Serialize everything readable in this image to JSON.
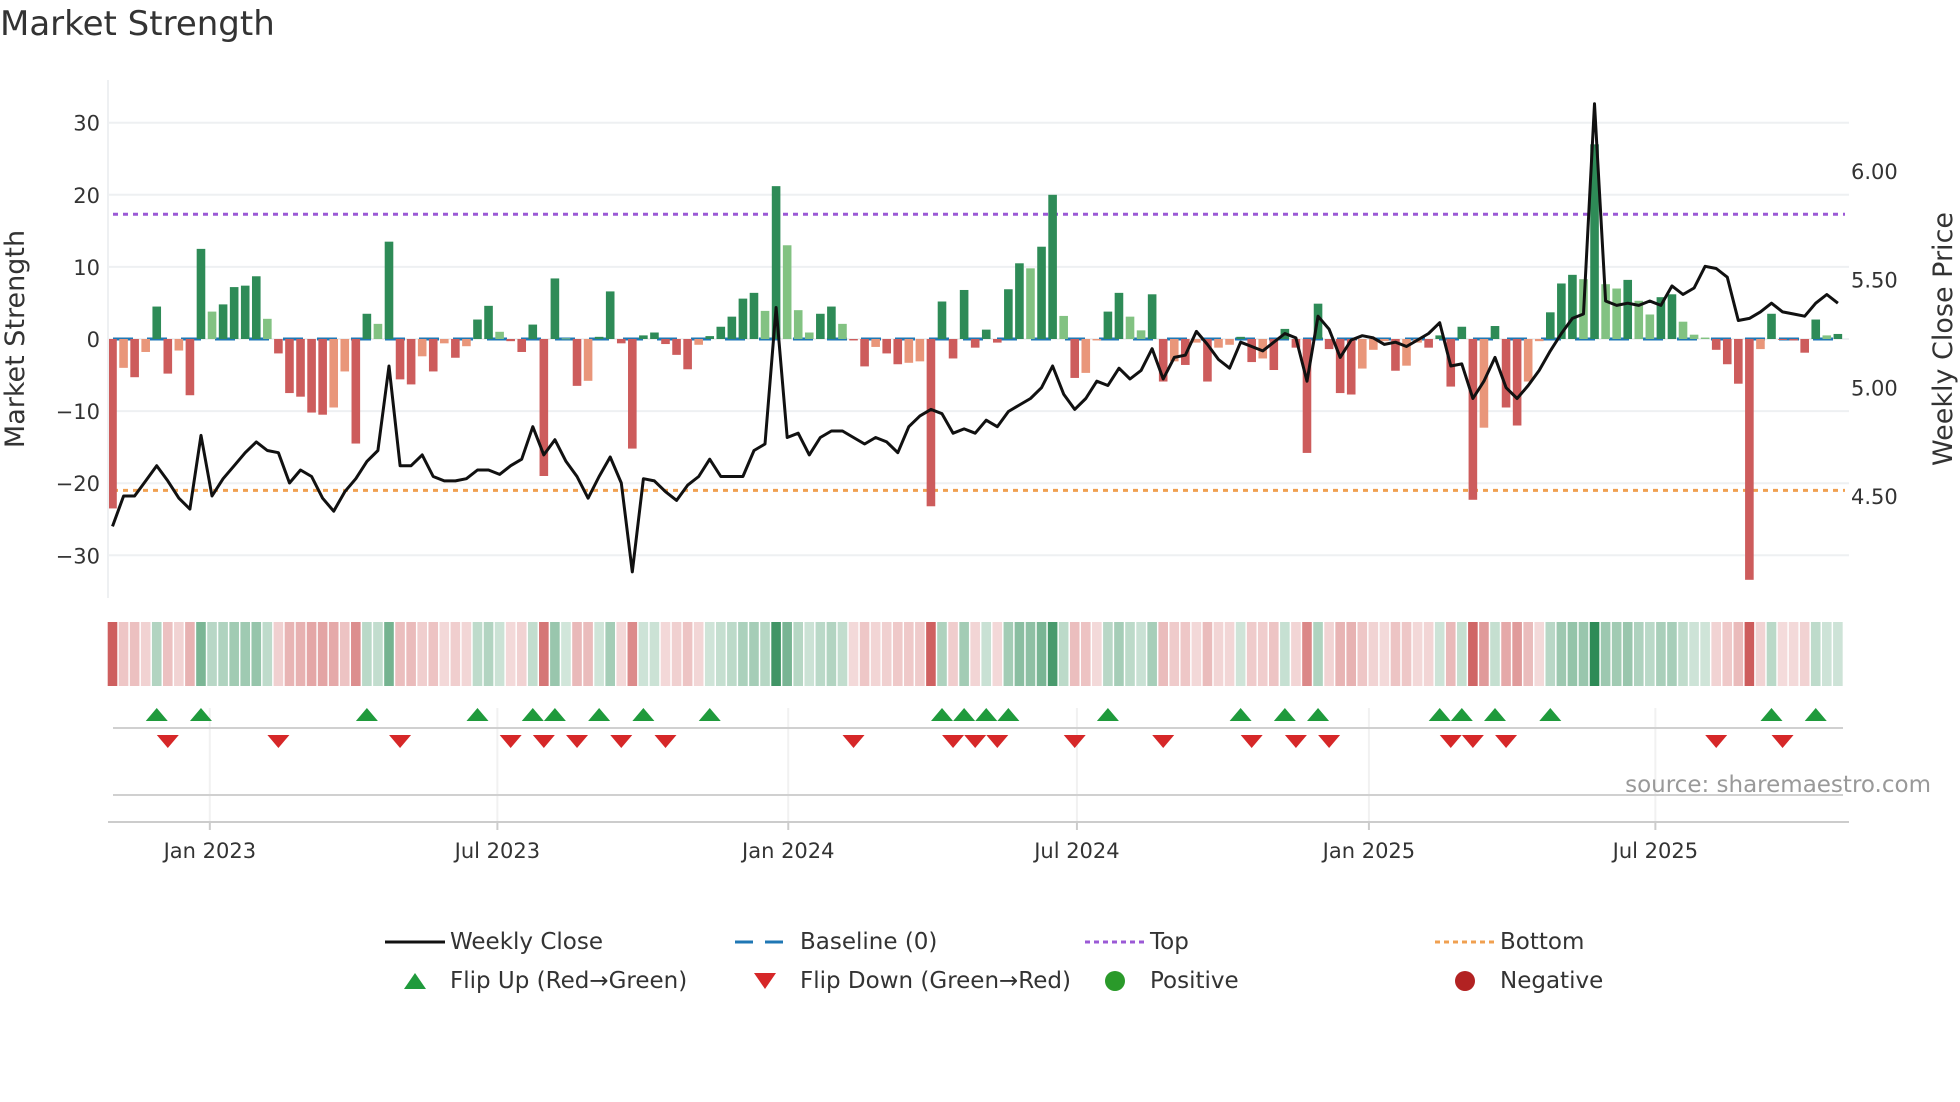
{
  "title": "Market Strength",
  "source": "source: sharemaestro.com",
  "colors": {
    "strong_green": "#2e8b57",
    "weak_green": "#82c282",
    "strong_red": "#cd5c5c",
    "weak_red": "#e9967a",
    "line": "#111111",
    "baseline": "#1f77b4",
    "top": "#9b59d6",
    "bottom": "#f0a050",
    "flip_up": "#1f9a3c",
    "flip_down": "#d62728",
    "positive": "#2a9a2a",
    "negative": "#b22222"
  },
  "legend": [
    {
      "key": "weekly-close",
      "label": "Weekly Close"
    },
    {
      "key": "baseline",
      "label": "Baseline (0)"
    },
    {
      "key": "top",
      "label": "Top"
    },
    {
      "key": "bottom",
      "label": "Bottom"
    },
    {
      "key": "flip-up",
      "label": "Flip Up (Red→Green)"
    },
    {
      "key": "flip-down",
      "label": "Flip Down (Green→Red)"
    },
    {
      "key": "positive",
      "label": "Positive"
    },
    {
      "key": "negative",
      "label": "Negative"
    }
  ],
  "chart_data": {
    "type": "bar",
    "title": "Market Strength",
    "ylabel": "Market Strength",
    "y2label": "Weekly Close Price",
    "ylim": [
      -36,
      36
    ],
    "y2lim": [
      4.05,
      6.3
    ],
    "yticks": [
      30,
      20,
      10,
      0,
      -10,
      -20,
      -30
    ],
    "yticklabels": [
      "30",
      "20",
      "10",
      "0",
      "−10",
      "−20",
      "−30"
    ],
    "y2ticks": [
      6.0,
      5.5,
      5.0,
      4.5
    ],
    "y2ticklabels": [
      "6.00",
      "5.50",
      "5.00",
      "4.50"
    ],
    "x_unit": "week index",
    "xticks": [
      {
        "label": "Jan 2023",
        "at": 8.8
      },
      {
        "label": "Jul 2023",
        "at": 34.8
      },
      {
        "label": "Jan 2024",
        "at": 61.1
      },
      {
        "label": "Jul 2024",
        "at": 87.2
      },
      {
        "label": "Jan 2025",
        "at": 113.6
      },
      {
        "label": "Jul 2025",
        "at": 139.5
      }
    ],
    "top_level": 17.3,
    "bottom_level": -21.0,
    "baseline": 0,
    "strength": [
      -23.5,
      -4,
      -5.3,
      -1.8,
      4.5,
      -4.8,
      -1.6,
      -7.8,
      12.5,
      3.8,
      4.8,
      7.2,
      7.4,
      8.7,
      2.8,
      -2,
      -7.5,
      -8,
      -10.2,
      -10.5,
      -9.5,
      -4.5,
      -14.5,
      3.5,
      2.1,
      13.5,
      -5.6,
      -6.3,
      -2.4,
      -4.5,
      -0.6,
      -2.6,
      -1,
      2.7,
      4.6,
      1,
      -0.3,
      -1.8,
      2,
      -19,
      8.4,
      0.1,
      -6.5,
      -5.8,
      0.3,
      6.6,
      -0.6,
      -15.2,
      0.5,
      0.9,
      -0.7,
      -2.2,
      -4.2,
      -0.8,
      0.4,
      1.7,
      3.1,
      5.6,
      6.4,
      3.9,
      21.2,
      13,
      4,
      0.9,
      3.5,
      4.5,
      2.1,
      -0.2,
      -3.8,
      -1.1,
      -2,
      -3.5,
      -3.3,
      -3.1,
      -23.2,
      5.2,
      -2.7,
      6.8,
      -1.2,
      1.3,
      -0.5,
      6.9,
      10.5,
      9.8,
      12.8,
      20,
      3.2,
      -5.4,
      -4.7,
      -0.2,
      3.8,
      6.4,
      3.1,
      1.2,
      6.2,
      -5.9,
      -3.1,
      -3.6,
      -0.5,
      -5.9,
      -1.2,
      -0.8,
      0.3,
      -3.2,
      -2.7,
      -4.3,
      1.4,
      -1.2,
      -15.8,
      4.9,
      -1.4,
      -7.5,
      -7.7,
      -4.1,
      -1.5,
      -0.3,
      -4.4,
      -3.7,
      -0.5,
      -1.2,
      0.5,
      -6.6,
      1.7,
      -22.3,
      -12.3,
      1.8,
      -9.5,
      -12,
      -5.9,
      -0.3,
      3.7,
      7.7,
      8.9,
      8.3,
      27,
      7.6,
      7,
      8.2,
      5.3,
      3.4,
      5.8,
      6.2,
      2.4,
      0.6,
      0.2,
      -1.5,
      -3.5,
      -6.2,
      -33.4,
      -1.4,
      3.5,
      -0.1,
      -0.2,
      -1.9,
      2.7,
      0.5,
      0.7
    ],
    "weekly_close": [
      4.36,
      4.5,
      4.5,
      4.57,
      4.64,
      4.57,
      4.49,
      4.44,
      4.78,
      4.5,
      4.58,
      4.64,
      4.7,
      4.75,
      4.71,
      4.7,
      4.56,
      4.62,
      4.59,
      4.49,
      4.43,
      4.52,
      4.58,
      4.66,
      4.71,
      5.1,
      4.64,
      4.64,
      4.69,
      4.59,
      4.57,
      4.57,
      4.58,
      4.62,
      4.62,
      4.6,
      4.64,
      4.67,
      4.82,
      4.69,
      4.76,
      4.66,
      4.59,
      4.49,
      4.59,
      4.68,
      4.56,
      4.15,
      4.58,
      4.57,
      4.52,
      4.48,
      4.55,
      4.59,
      4.67,
      4.59,
      4.59,
      4.59,
      4.71,
      4.74,
      5.37,
      4.77,
      4.79,
      4.69,
      4.77,
      4.8,
      4.8,
      4.77,
      4.74,
      4.77,
      4.75,
      4.7,
      4.82,
      4.87,
      4.9,
      4.88,
      4.79,
      4.81,
      4.79,
      4.85,
      4.82,
      4.89,
      4.92,
      4.95,
      5.0,
      5.1,
      4.97,
      4.9,
      4.95,
      5.03,
      5.01,
      5.09,
      5.04,
      5.08,
      5.18,
      5.04,
      5.14,
      5.15,
      5.26,
      5.2,
      5.13,
      5.09,
      5.21,
      5.19,
      5.17,
      5.21,
      5.25,
      5.23,
      5.03,
      5.33,
      5.27,
      5.14,
      5.22,
      5.24,
      5.23,
      5.2,
      5.21,
      5.19,
      5.22,
      5.25,
      5.3,
      5.1,
      5.11,
      4.95,
      5.03,
      5.14,
      5.0,
      4.95,
      5.01,
      5.08,
      5.17,
      5.25,
      5.32,
      5.34,
      6.31,
      5.4,
      5.38,
      5.39,
      5.38,
      5.4,
      5.38,
      5.47,
      5.43,
      5.46,
      5.56,
      5.55,
      5.51,
      5.31,
      5.32,
      5.35,
      5.39,
      5.35,
      5.34,
      5.33,
      5.39,
      5.43,
      5.39
    ],
    "legend_placement": "bottom"
  }
}
